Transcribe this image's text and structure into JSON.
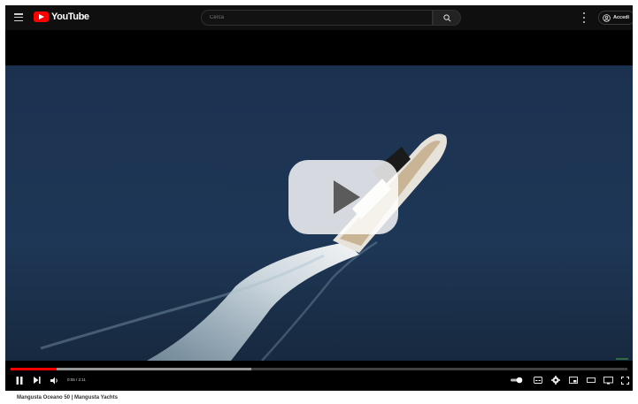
{
  "masthead": {
    "logo_text": "YouTube",
    "search_placeholder": "Cerca",
    "signin_label": "Accedi"
  },
  "player": {
    "time_display": "0:05 / 2:11",
    "progress_fraction": 0.075,
    "buffer_fraction": 0.39
  },
  "video": {
    "title": "Mangusta Oceano 50 | Mangusta Yachts"
  },
  "colors": {
    "accent": "#ff0000",
    "sea": "#1d3350"
  },
  "icons": [
    "menu-icon",
    "youtube-logo-icon",
    "search-icon",
    "more-vert-icon",
    "account-icon",
    "play-icon",
    "pause-icon",
    "next-icon",
    "volume-icon",
    "autoplay-toggle-icon",
    "subtitles-icon",
    "settings-icon",
    "miniplayer-icon",
    "theater-icon",
    "cast-icon",
    "fullscreen-icon"
  ]
}
